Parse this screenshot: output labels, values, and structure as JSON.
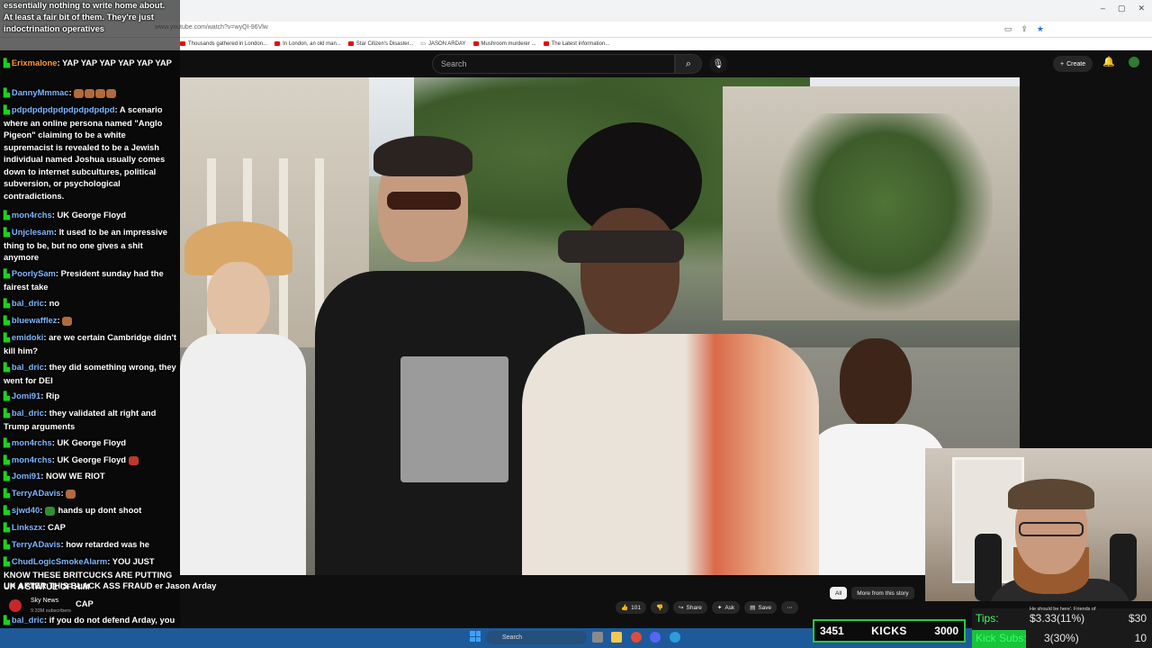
{
  "browser": {
    "url": "www.youtube.com/watch?v=wyQI-96Vlw",
    "bookmarks": [
      "Thousands gathered in London...",
      "In London, an old man...",
      "Star Citizen's Disaster...",
      "JASON ARDAY",
      "Mushroom murderer ...",
      "The Latest information..."
    ],
    "window_controls": [
      "–",
      "▢",
      "✕"
    ]
  },
  "youtube": {
    "search_placeholder": "Search",
    "create_label": "Create",
    "video_title": "UK AFTER THIS BLACK ASS FRAUD er Jason Arday",
    "channel": {
      "name": "Sky News",
      "subscribers": "9.33M subscribers"
    },
    "likes": "101",
    "actions": {
      "share": "Share",
      "ask": "Ask",
      "save": "Save"
    },
    "rec_tabs": {
      "all": "All",
      "more": "More from this story"
    }
  },
  "chat": {
    "overlay_lines": [
      "essentially nothing to write home about.",
      "At least a fair bit of them. They're just",
      "indoctrination operatives"
    ],
    "messages": [
      {
        "user": "Erixmalone",
        "text": "YAP YAP YAP YAP YAP YAP",
        "color": "orange"
      },
      {
        "user": "DannyMmmac",
        "text": ""
      },
      {
        "user": "pdpdpdpdpdpdpdpdpdpd",
        "text": "A scenario where an online persona named \"Anglo Pigeon\" claiming to be a white supremacist is revealed to be a Jewish individual named Joshua usually comes down to internet subcultures, political subversion, or psychological contradictions."
      },
      {
        "user": "mon4rchs",
        "text": "UK George Floyd"
      },
      {
        "user": "Unjclesam",
        "text": "It used to be an impressive thing to be, but no one gives a shit anymore"
      },
      {
        "user": "PoorlySam",
        "text": "President sunday had the fairest take"
      },
      {
        "user": "bal_dric",
        "text": "no"
      },
      {
        "user": "bluewafflez",
        "text": ""
      },
      {
        "user": "emidoki",
        "text": "are we certain Cambridge didn't kill him?"
      },
      {
        "user": "bal_dric",
        "text": "they did something wrong, they went for DEI"
      },
      {
        "user": "Jomi91",
        "text": "Rip"
      },
      {
        "user": "bal_dric",
        "text": "they validated alt right and Trump arguments"
      },
      {
        "user": "mon4rchs",
        "text": "UK George Floyd"
      },
      {
        "user": "mon4rchs",
        "text": "UK George Floyd"
      },
      {
        "user": "Jomi91",
        "text": "NOW WE RIOT"
      },
      {
        "user": "TerryADavis",
        "text": ""
      },
      {
        "user": "sjwd40",
        "text": "hands up dont shoot"
      },
      {
        "user": "Linkszx",
        "text": "CAP"
      },
      {
        "user": "TerryADavis",
        "text": "how retarded was he"
      },
      {
        "user": "ChudLogicSmokeAlarm",
        "text": "YOU JUST KNOW THESE BRITCUCKS ARE PUTTING UP A STATUE OF HIM"
      },
      {
        "user": "",
        "text": "CAP"
      },
      {
        "user": "bal_dric",
        "text": "if you do not defend Arday, you are pro Trump"
      }
    ]
  },
  "taskbar": {
    "search": "Search"
  },
  "stream": {
    "kicks": {
      "current": "3451",
      "label": "KICKS",
      "goal": "3000"
    },
    "tips": {
      "label": "Tips:",
      "value": "$3.33(11%)",
      "goal": "$30"
    },
    "kick_subs": {
      "label": "Kick Subs:",
      "value": "3(30%)",
      "goal": "10"
    },
    "notice": "He should be here'. Friends of"
  }
}
